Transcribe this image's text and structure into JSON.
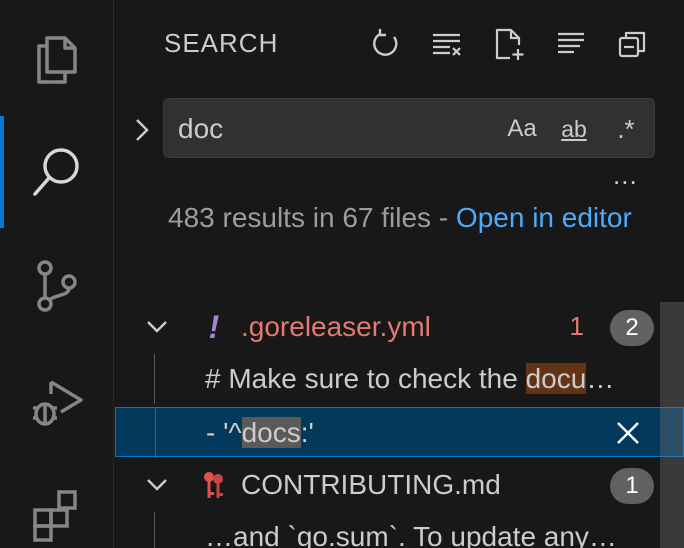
{
  "sidebar": {
    "title": "SEARCH"
  },
  "search": {
    "query": "doc",
    "options": {
      "match_case": "Aa",
      "whole_word": "ab",
      "regex": ".*"
    },
    "more": "..."
  },
  "summary": {
    "text": "483 results in 67 files - ",
    "link": "Open in editor"
  },
  "results": {
    "file1": {
      "name": ".goreleaser.yml",
      "icon": "!",
      "problem_count": "1",
      "match_count": "2",
      "name_color": "#e27a71",
      "icon_color": "#b180d7",
      "matches": [
        {
          "before": "# Make sure to check the ",
          "hit": "docu",
          "after": "…"
        },
        {
          "before": "- '^",
          "hit": "docs",
          "after": ":'"
        }
      ]
    },
    "file2": {
      "name": "CONTRIBUTING.md",
      "match_count": "1",
      "icon_color": "#e05252",
      "matches": [
        {
          "before": "…and `go.sum`. To update any…",
          "hit": "",
          "after": ""
        }
      ]
    }
  }
}
